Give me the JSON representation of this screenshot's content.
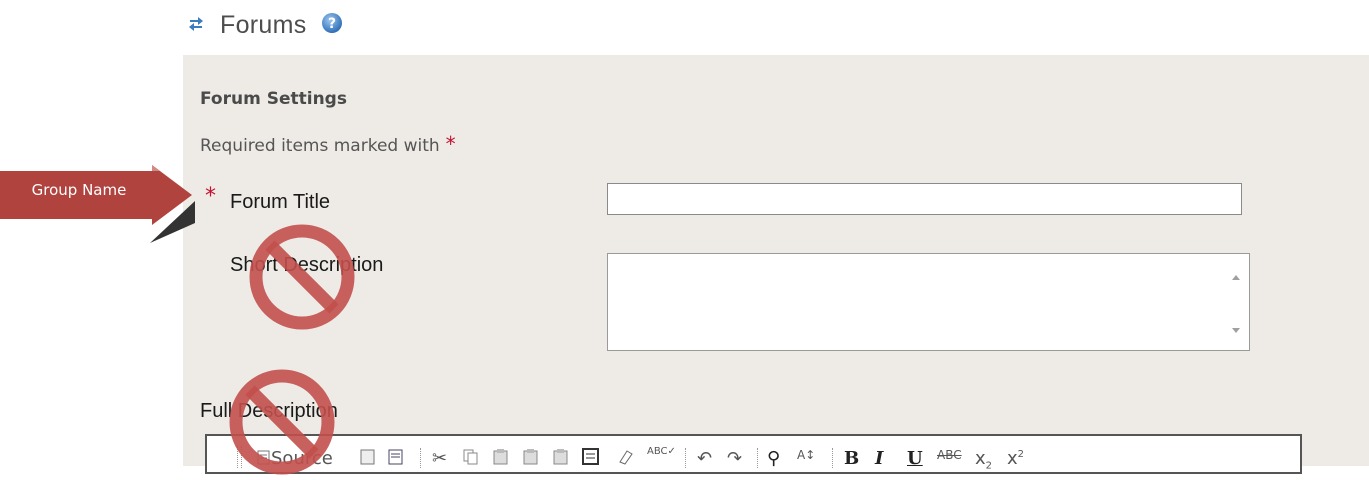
{
  "header": {
    "title": "Forums",
    "sync_icon": "sync-arrows-icon",
    "help_icon": "help-icon"
  },
  "settings": {
    "heading": "Forum Settings",
    "required_note": "Required items marked with",
    "required_star": "*",
    "forum_title_label": "Forum Title",
    "forum_title_value": "",
    "short_description_label": "Short Description",
    "full_description_label": "Full Description"
  },
  "toolbar": {
    "items": [
      "Source",
      "cut-icon",
      "copy-icon",
      "paste-icon",
      "paste-text-icon",
      "paste-word-icon",
      "print-icon",
      "remove-format-icon",
      "spellcheck-icon",
      "undo-icon",
      "redo-icon",
      "find-icon",
      "replace-icon",
      "bold-icon",
      "italic-icon",
      "underline-icon",
      "strikethrough-icon",
      "subscript-icon",
      "superscript-icon"
    ],
    "source_label": "Source",
    "bold": "B",
    "italic": "I",
    "underline": "U"
  },
  "annotation": {
    "callout_text": "Group Name",
    "callout_color": "#b0433e",
    "prohibit_color": "#c2504c"
  }
}
